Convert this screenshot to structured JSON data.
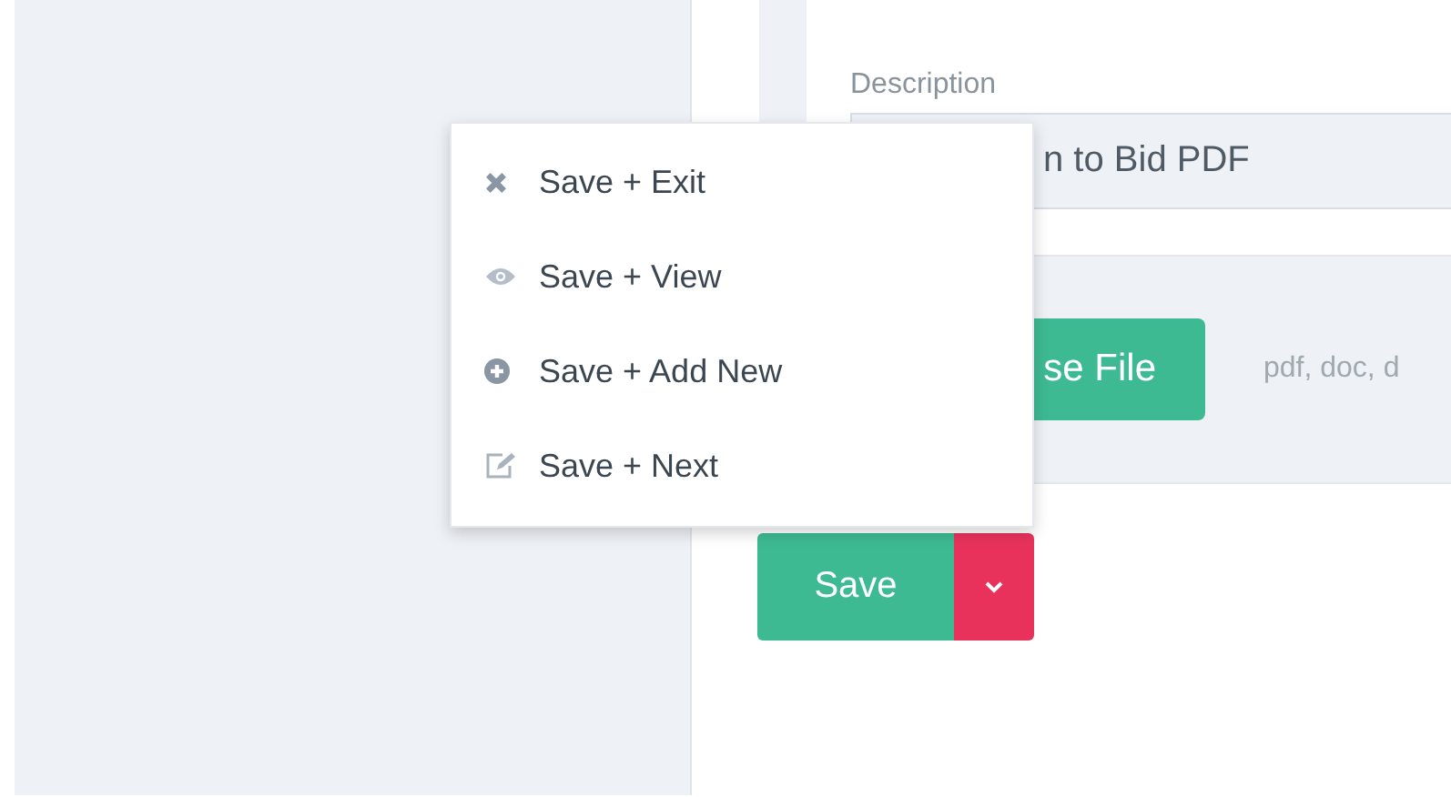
{
  "form": {
    "description": {
      "label": "Description",
      "value": "n to Bid PDF"
    },
    "file": {
      "button": "se File",
      "hint": "pdf, doc, d"
    }
  },
  "save": {
    "label": "Save",
    "menu_open": true
  },
  "menu": [
    {
      "kind": "close",
      "label": "Save + Exit"
    },
    {
      "kind": "eye",
      "label": "Save + View"
    },
    {
      "kind": "plus",
      "label": "Save + Add New"
    },
    {
      "kind": "edit",
      "label": "Save + Next"
    }
  ]
}
